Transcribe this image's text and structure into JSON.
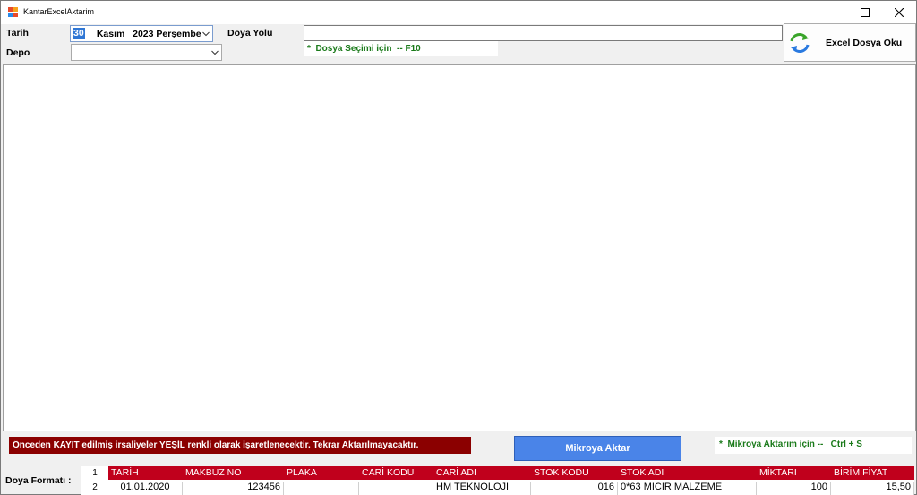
{
  "window": {
    "title": "KantarExcelAktarim"
  },
  "form": {
    "tarih_label": "Tarih",
    "depo_label": "Depo",
    "doya_yolu_label": "Doya Yolu",
    "date_day": "30",
    "date_rest": "  Kasım   2023 Perşembe",
    "depo_value": "",
    "path_value": "",
    "file_hint": "*  Dosya Seçimi için  -- F10",
    "excel_button": "Excel Dosya Oku"
  },
  "footer": {
    "warning": "Önceden KAYIT edilmiş irsaliyeler YEŞİL renkli olarak işaretlenecektir. Tekrar Aktarılmayacaktır.",
    "transfer_button": "Mikroya Aktar",
    "transfer_hint": "*  Mikroya Aktarım için --   Ctrl + S",
    "format_label": "Doya Formatı :"
  },
  "format_table": {
    "row_numbers": [
      "1",
      "2"
    ],
    "headers": [
      "TARİH",
      "MAKBUZ NO",
      "PLAKA",
      "CARİ KODU",
      "CARİ ADI",
      "STOK KODU",
      "STOK ADI",
      "MİKTARI",
      "BİRİM FİYAT"
    ],
    "row": [
      "01.01.2020",
      "123456",
      "",
      "",
      "HM TEKNOLOJİ",
      "016",
      "0*63 MICIR MALZEME",
      "100",
      "15,50"
    ]
  },
  "colors": {
    "header_red": "#c0001c",
    "warning_red": "#8b0000",
    "hint_green": "#1a7a1a",
    "button_blue": "#4a84e8"
  }
}
